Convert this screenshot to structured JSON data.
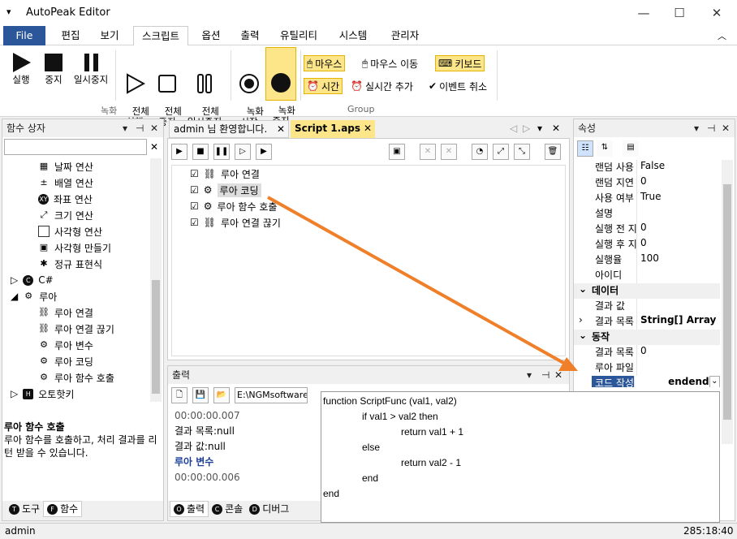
{
  "app": {
    "title": "AutoPeak Editor"
  },
  "menu": {
    "file": "File",
    "tabs": [
      "편집",
      "보기",
      "스크립트",
      "옵션",
      "출력",
      "유틸리티",
      "시스템",
      "관리자"
    ]
  },
  "ribbon": {
    "run": "실행",
    "stop": "중지",
    "pause": "일시중지",
    "all_run": "전체\n실행",
    "all_stop": "전체\n중지",
    "all_pause": "전체\n일시중지",
    "rec_start": "녹화\n시작",
    "rec_stop": "녹화\n중지",
    "mouse": "마우스",
    "mouse_move": "마우스 이동",
    "keyboard": "키보드",
    "time": "시간",
    "realtime_add": "실시간 추가",
    "event_cancel": "이벤트 취소",
    "group_record": "녹화",
    "group_group": "Group"
  },
  "func_box": {
    "title": "함수 상자",
    "items": [
      "날짜 연산",
      "배열 연산",
      "좌표 연산",
      "크기 연산",
      "사각형 연산",
      "사각형 만들기",
      "정규 표현식"
    ],
    "cs": "C#",
    "lua": "루아",
    "lua_items": [
      "루아 연결",
      "루아 연결 끊기",
      "루아 변수",
      "루아 코딩",
      "루아 함수 호출"
    ],
    "hotkey": "오토핫키",
    "desc_title": "루아 함수 호출",
    "desc_text": "루아 함수를 호출하고, 처리 결과를 리턴 받을 수 있습니다.",
    "tab_tools": "도구",
    "tab_funcs": "함수"
  },
  "doc_tabs": {
    "welcome": "admin 님 환영합니다.",
    "script": "Script 1.aps"
  },
  "script": {
    "lines": [
      "루아 연결",
      "루아 코딩",
      "루아 함수 호출",
      "루아 연결 끊기"
    ]
  },
  "output": {
    "title": "출력",
    "path": "E:\\NGMsoftware\\",
    "lines": [
      "00:00:00.007",
      "결과 목록:null",
      "결과 값:null",
      "",
      "루아 변수",
      "00:00:00.006"
    ],
    "tabs": [
      "출력",
      "콘솔",
      "디버그"
    ]
  },
  "props": {
    "title": "속성",
    "rows": [
      [
        "랜덤 사용",
        "False"
      ],
      [
        "랜덤 지연",
        "0"
      ],
      [
        "사용 여부",
        "True"
      ],
      [
        "설명",
        ""
      ],
      [
        "실행 전 지",
        "0"
      ],
      [
        "실행 후 지",
        "0"
      ],
      [
        "실행율",
        "100"
      ],
      [
        "아이디",
        ""
      ]
    ],
    "cat_data": "데이터",
    "data_rows": [
      [
        "결과 값",
        ""
      ],
      [
        "결과 목록",
        "String[] Array"
      ]
    ],
    "cat_action": "동작",
    "action_rows": [
      [
        "결과 목록",
        "0"
      ],
      [
        "루아 파일",
        ""
      ]
    ],
    "code_key": "코드 작성",
    "code_val": "endend"
  },
  "code_popup": {
    "lines": [
      "function ScriptFunc (val1, val2)",
      "if val1 > val2 then",
      "return val1 + 1",
      "else",
      "return val2 - 1",
      "end",
      "end"
    ]
  },
  "status": {
    "user": "admin",
    "pos": "285:18:40"
  },
  "colors": {
    "accent": "#2b579a",
    "highlight": "#fde68a",
    "arrow": "#f07f2a"
  }
}
